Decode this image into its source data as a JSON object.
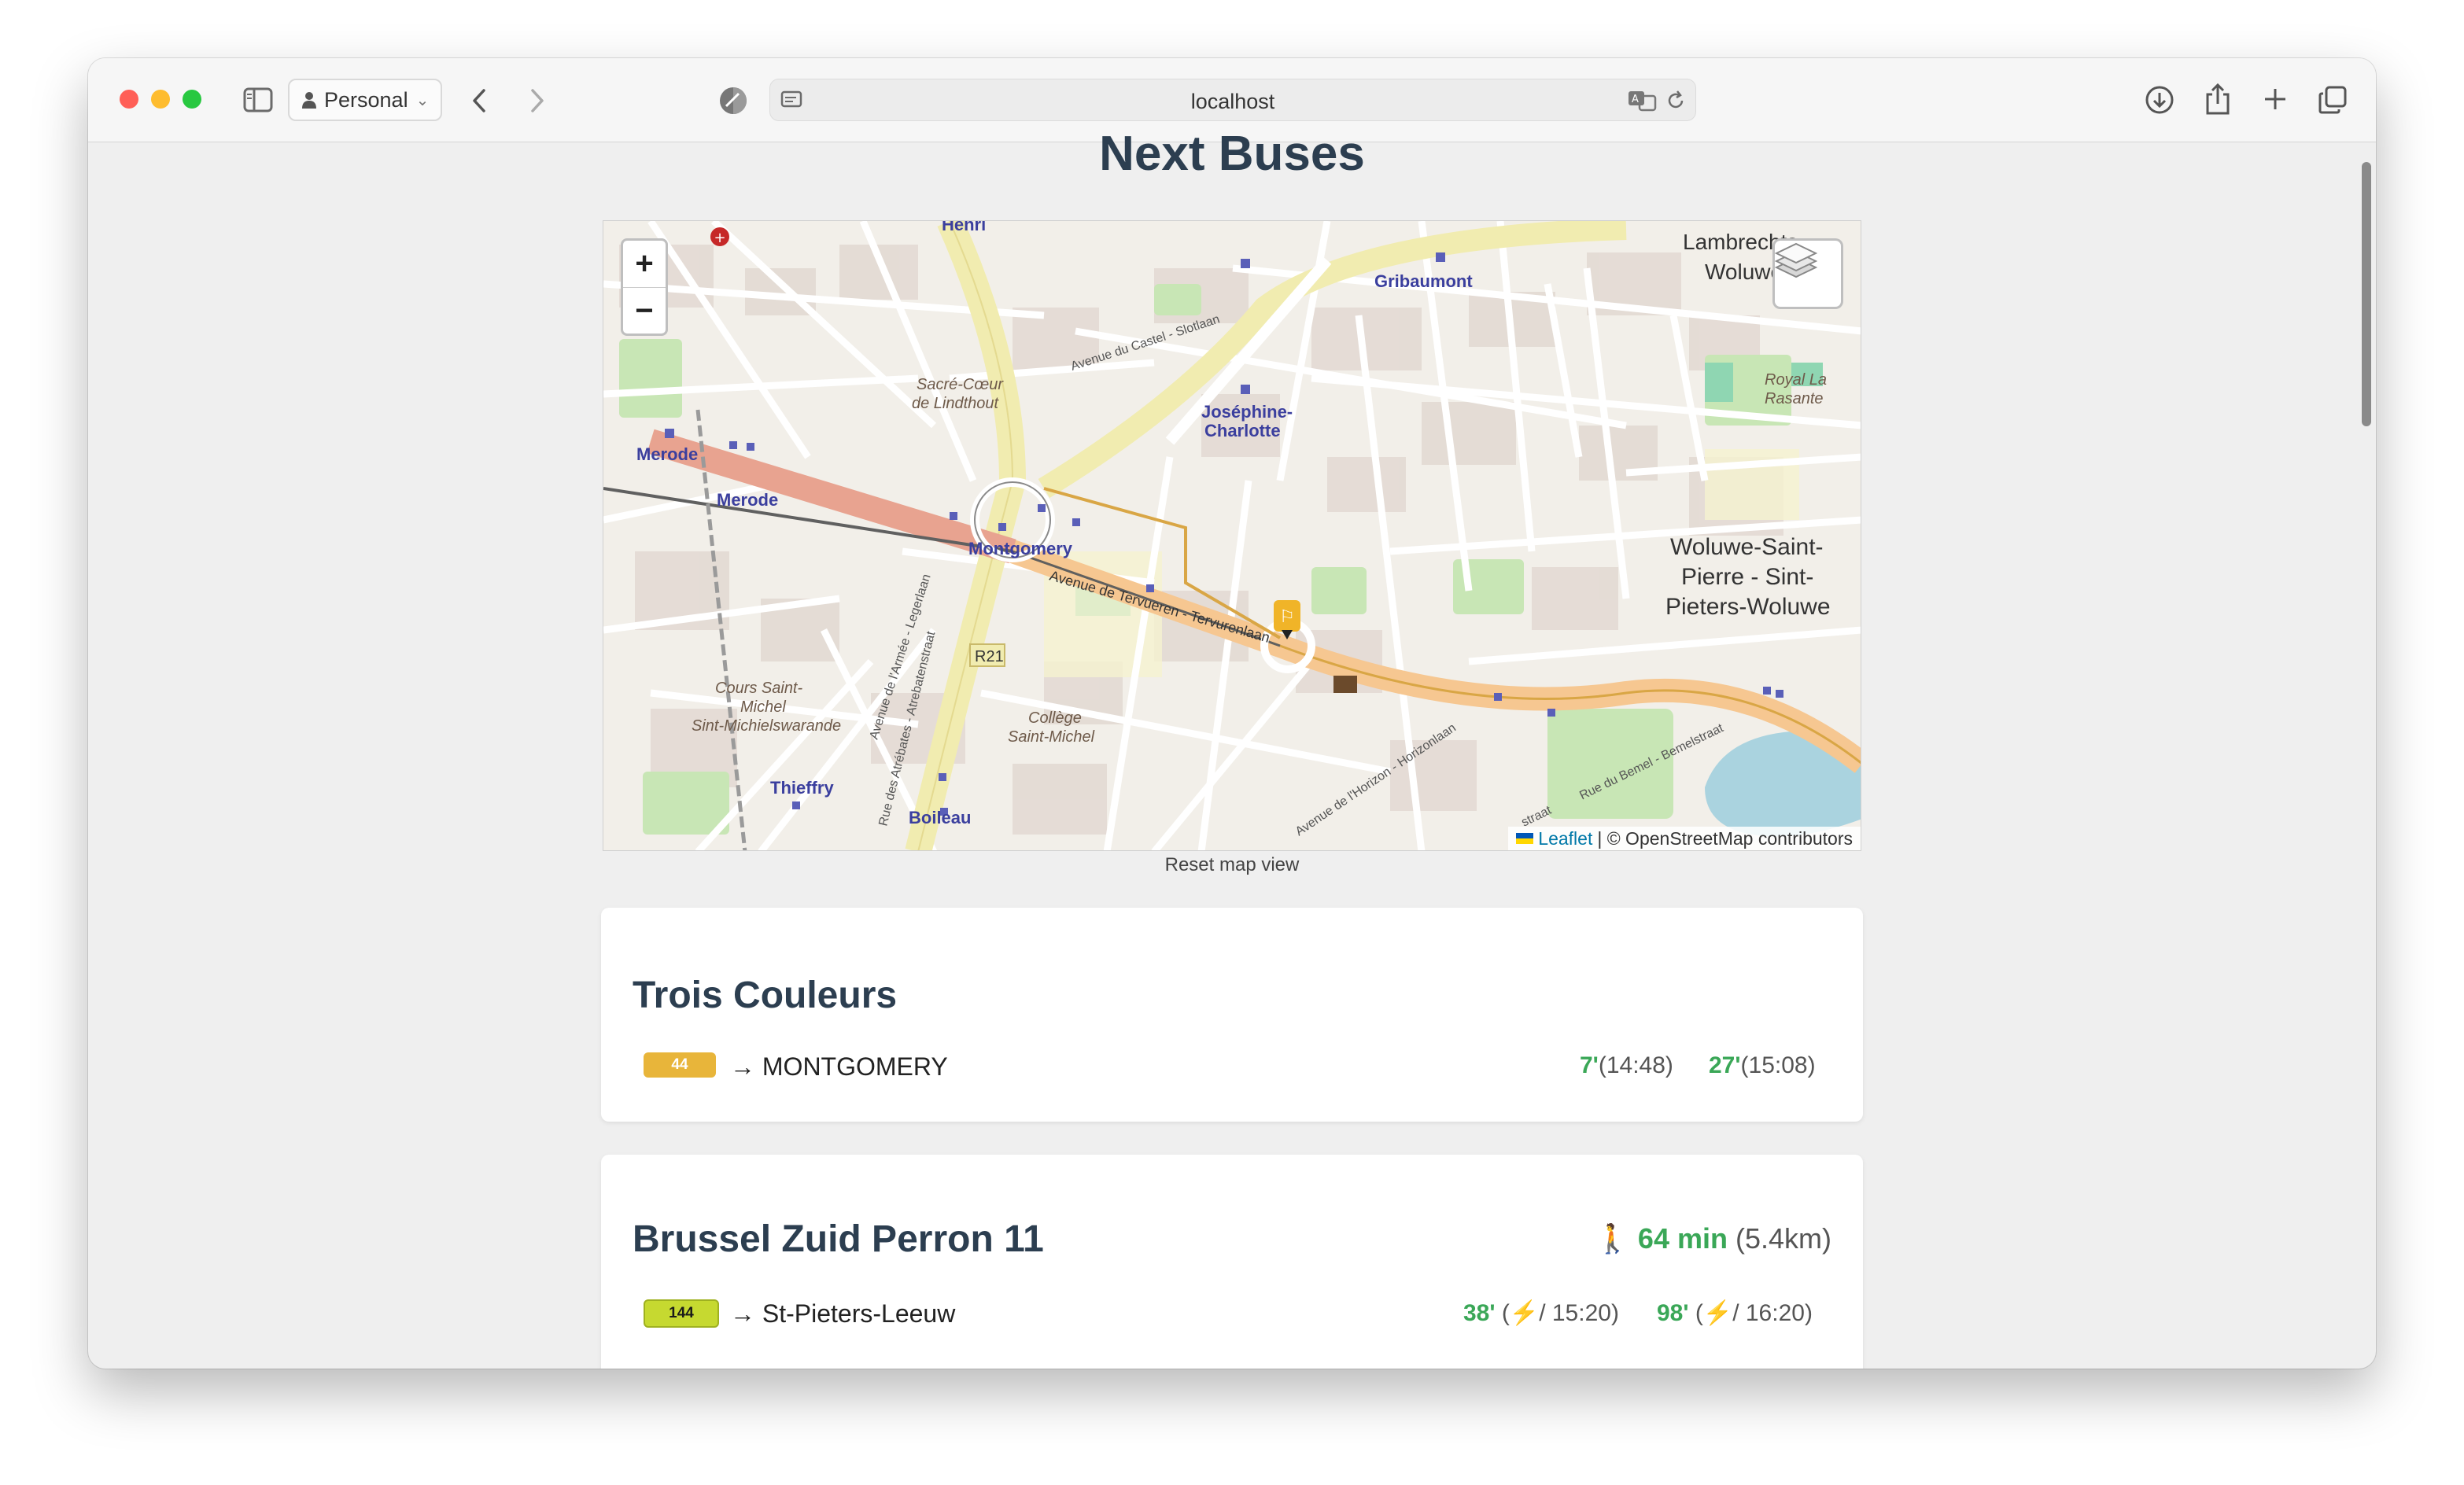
{
  "browser": {
    "profile": "Personal",
    "url": "localhost"
  },
  "page": {
    "title": "Next Buses",
    "reset_map": "Reset map view"
  },
  "map": {
    "zoom_in": "+",
    "zoom_out": "−",
    "attribution_leaflet": "Leaflet",
    "attribution_osm": "| © OpenStreetMap contributors",
    "labels": {
      "henri": "Henri",
      "gribaumont": "Gribaumont",
      "lambrechts_1": "Lambrechts-",
      "lambrechts_2": "Woluwe",
      "avenue_castel": "Avenue du Castel - Slotlaan",
      "sacre_coeur_1": "Sacré-Cœur",
      "sacre_coeur_2": "de Lindthout",
      "josephine_1": "Joséphine-",
      "josephine_2": "Charlotte",
      "royal_la_1": "Royal La",
      "royal_la_2": "Rasante",
      "merode_1": "Merode",
      "merode_2": "Merode",
      "montgomery": "Montgomery",
      "woluwe_1": "Woluwe-Saint-",
      "woluwe_2": "Pierre - Sint-",
      "woluwe_3": "Pieters-Woluwe",
      "tervueren": "Avenue de Tervueren - Tervurenlaan",
      "r21": "R21",
      "cours_1": "Cours Saint-",
      "cours_2": "Michel",
      "cours_3": "Sint-Michielswarande",
      "college_1": "Collège",
      "college_2": "Saint-Michel",
      "thieffry": "Thieffry",
      "boileau": "Boileau",
      "avenue_armee": "Avenue de l'Armée - Legerlaan",
      "rue_atrebates": "Rue des Atrébates - Atrebatenstraat",
      "avenue_horizon": "Avenue de l'Horizon - Horizonlaan",
      "rue_bemel": "Rue du Bemel - Bemelstraat",
      "straat": "straat"
    }
  },
  "stops": [
    {
      "name": "Trois Couleurs",
      "walk_time": "",
      "walk_dist": "",
      "departures": [
        {
          "line": "44",
          "line_color": "#e8b53a",
          "text_color": "#ffffff",
          "destination": "→ MONTGOMERY",
          "times": [
            {
              "min": "7'",
              "detail": "(14:48)"
            },
            {
              "min": "27'",
              "detail": "(15:08)"
            }
          ]
        }
      ]
    },
    {
      "name": "Brussel Zuid Perron 11",
      "walk_icon": "🚶",
      "walk_time": "64 min",
      "walk_dist": "(5.4km)",
      "departures": [
        {
          "line": "144",
          "line_color": "#c6d930",
          "text_color": "#1a1a1a",
          "destination": "→ St-Pieters-Leeuw",
          "times": [
            {
              "min": "38'",
              "detail": "(⚡/ 15:20)"
            },
            {
              "min": "98'",
              "detail": "(⚡/ 16:20)"
            }
          ]
        }
      ]
    }
  ]
}
